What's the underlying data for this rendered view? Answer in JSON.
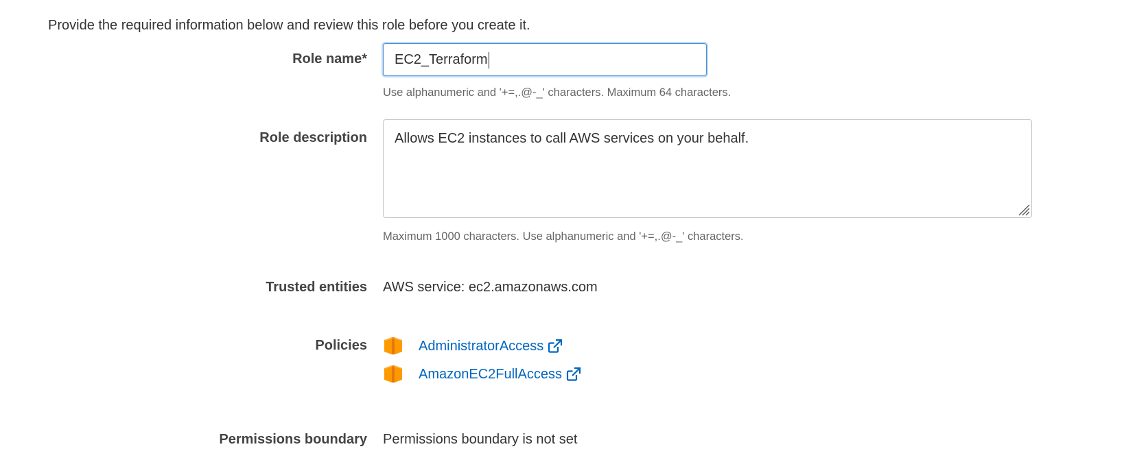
{
  "intro": "Provide the required information below and review this role before you create it.",
  "role_name": {
    "label": "Role name*",
    "value": "EC2_Terraform",
    "help": "Use alphanumeric and '+=,.@-_' characters. Maximum 64 characters."
  },
  "role_description": {
    "label": "Role description",
    "value": "Allows EC2 instances to call AWS services on your behalf.",
    "help": "Maximum 1000 characters. Use alphanumeric and '+=,.@-_' characters."
  },
  "trusted_entities": {
    "label": "Trusted entities",
    "value": "AWS service: ec2.amazonaws.com"
  },
  "policies": {
    "label": "Policies",
    "items": [
      {
        "name": "AdministratorAccess",
        "icon": "aws-policy-box-icon"
      },
      {
        "name": "AmazonEC2FullAccess",
        "icon": "aws-policy-box-icon"
      }
    ]
  },
  "permissions_boundary": {
    "label": "Permissions boundary",
    "value": "Permissions boundary is not set"
  },
  "colors": {
    "link": "#0066c0",
    "focus_border": "#4a90d9",
    "policy_icon": "#f90"
  }
}
